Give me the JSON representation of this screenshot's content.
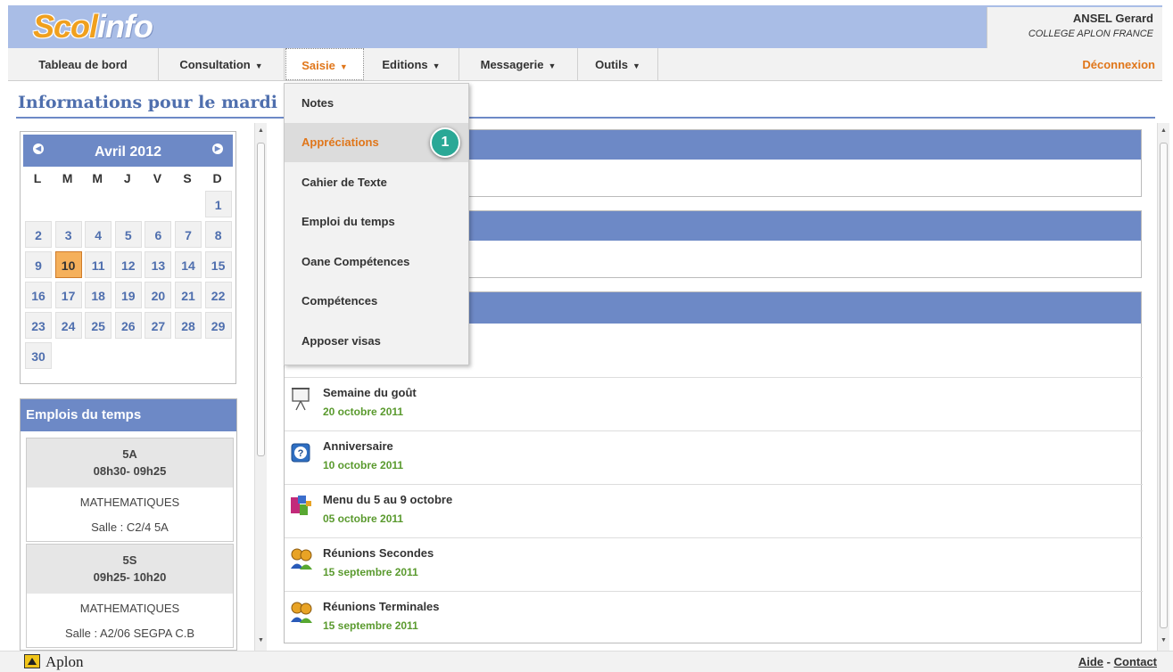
{
  "header": {
    "logo_part1": "Scol",
    "logo_part2": "info",
    "user_name": "ANSEL Gerard",
    "school": "COLLEGE APLON FRANCE"
  },
  "menu": {
    "items": [
      "Tableau de bord",
      "Consultation",
      "Saisie",
      "Editions",
      "Messagerie",
      "Outils"
    ],
    "caret": "▼",
    "logout": "Déconnexion"
  },
  "page_title": "Informations pour le mardi",
  "calendar": {
    "month": "Avril 2012",
    "prev_icon": "arrow-left",
    "next_icon": "arrow-right",
    "dow": [
      "L",
      "M",
      "M",
      "J",
      "V",
      "S",
      "D"
    ],
    "weeks": [
      [
        "",
        "",
        "",
        "",
        "",
        "",
        "1"
      ],
      [
        "2",
        "3",
        "4",
        "5",
        "6",
        "7",
        "8"
      ],
      [
        "9",
        "10",
        "11",
        "12",
        "13",
        "14",
        "15"
      ],
      [
        "16",
        "17",
        "18",
        "19",
        "20",
        "21",
        "22"
      ],
      [
        "23",
        "24",
        "25",
        "26",
        "27",
        "28",
        "29"
      ],
      [
        "30",
        "",
        "",
        "",
        "",
        "",
        ""
      ]
    ],
    "today": "10"
  },
  "edt": {
    "title": "Emplois du temps",
    "blocks": [
      {
        "class": "5A",
        "time": "08h30- 09h25",
        "subject": "MATHEMATIQUES",
        "room": "Salle : C2/4 5A"
      },
      {
        "class": "5S",
        "time": "09h25- 10h20",
        "subject": "MATHEMATIQUES",
        "room": "Salle : A2/06 SEGPA C.B"
      }
    ]
  },
  "dropdown": {
    "items": [
      "Notes",
      "Appréciations",
      "Cahier de Texte",
      "Emploi du temps",
      "Oane Compétences",
      "Compétences",
      "Apposer visas"
    ],
    "active": "Appréciations",
    "badge": "1"
  },
  "news": [
    {
      "icon": "presentation-board-icon",
      "title": "Semaine du goût",
      "date": "20 octobre 2011"
    },
    {
      "icon": "help-question-icon",
      "title": "Anniversaire",
      "date": "10 octobre 2011"
    },
    {
      "icon": "menu-blocks-icon",
      "title": "Menu du 5 au 9 octobre",
      "date": "05 octobre 2011"
    },
    {
      "icon": "users-meeting-icon",
      "title": "Réunions Secondes",
      "date": "15 septembre 2011"
    },
    {
      "icon": "users-meeting-icon",
      "title": "Réunions Terminales",
      "date": "15 septembre 2011"
    }
  ],
  "footer": {
    "brand": "Aplon",
    "help": "Aide",
    "separator": "-",
    "contact": "Contact"
  },
  "colors": {
    "header_bg": "#a9bde6",
    "panel_blue": "#6d89c6",
    "accent_orange": "#e0761a",
    "date_green": "#5a9a2e",
    "badge_teal": "#2aa896"
  }
}
